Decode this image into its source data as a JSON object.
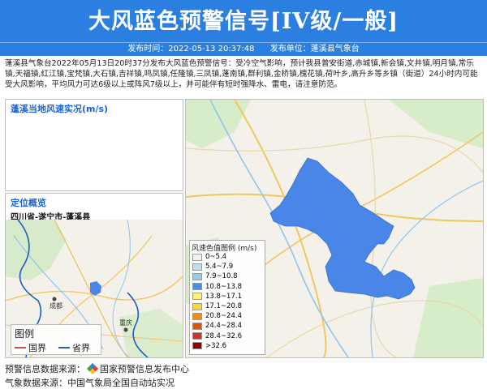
{
  "header": {
    "title": "大风蓝色预警信号[IV级/一般]",
    "publish_time_label": "发布时间：2022-05-13 20:37:48",
    "publish_unit_label": "发布单位：蓬溪县气象台"
  },
  "description": "蓬溪县气象台2022年05月13日20时37分发布大风蓝色预警信号：受冷空气影响，预计我县普安街道,赤城镇,新会镇,文井镇,明月镇,常乐镇,天福镇,红江镇,宝梵镇,大石镇,吉祥镇,鸣凤镇,任隆镇,三凤镇,蓬南镇,群利镇,金桥镇,槐花镇,荷叶乡,高升乡等乡镇（街道）24小时内可能受大风影响，平均风力可达6级以上或阵风7级以上，并可能伴有短时强降水、雷电，请注意防范。",
  "wind_panel": {
    "title": "蓬溪当地风速实况(m/s)"
  },
  "location_panel": {
    "title": "定位概览",
    "region": "四川省-遂宁市-蓬溪县"
  },
  "map_labels": {
    "chengdu": "成都",
    "chongqing": "重庆"
  },
  "mini_legend": {
    "title": "图例",
    "items": [
      {
        "label": "国界",
        "color": "#c0504d"
      },
      {
        "label": "省界",
        "color": "#1f5fbf"
      }
    ]
  },
  "wind_legend": {
    "title": "风速色值图例 (m/s)",
    "items": [
      {
        "label": "0~5.4",
        "color": "#f2f2f2"
      },
      {
        "label": "5.4~7.9",
        "color": "#c6dbef"
      },
      {
        "label": "7.9~10.8",
        "color": "#9ecae1"
      },
      {
        "label": "10.8~13.8",
        "color": "#4a90e2"
      },
      {
        "label": "13.8~17.1",
        "color": "#fff176"
      },
      {
        "label": "17.1~20.8",
        "color": "#fdd835"
      },
      {
        "label": "20.8~24.4",
        "color": "#fb8c00"
      },
      {
        "label": "24.4~28.4",
        "color": "#e65100"
      },
      {
        "label": "28.4~32.6",
        "color": "#d32f2f"
      },
      {
        "label": ">32.6",
        "color": "#8b0000"
      }
    ]
  },
  "footer": {
    "source_label": "预警信息数据来源：",
    "source_name": "国家预警信息发布中心",
    "weather_source": "气象数据来源：中国气象局全国自动站实况"
  },
  "colors": {
    "header_bg": "#2a7fe0",
    "warning_fill": "#4a86e8",
    "panel_title": "#1b63d6"
  }
}
